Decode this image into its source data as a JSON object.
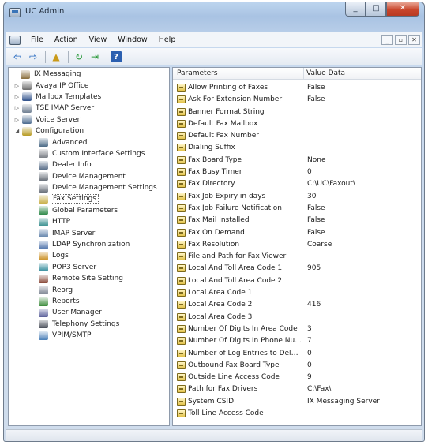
{
  "window": {
    "title": "UC Admin",
    "caption_buttons": {
      "minimize": "_",
      "maximize": "□",
      "close": "✕"
    }
  },
  "menubar": {
    "items": [
      "File",
      "Action",
      "View",
      "Window",
      "Help"
    ],
    "mdi_buttons": {
      "minimize": "_",
      "restore": "▫",
      "close": "✕"
    }
  },
  "toolbar": {
    "buttons": [
      {
        "name": "back",
        "icon": "arrow-left-icon",
        "glyph": "⇦"
      },
      {
        "name": "forward",
        "icon": "arrow-right-icon",
        "glyph": "⇨"
      },
      {
        "name": "up",
        "icon": "folder-up-icon",
        "glyph": "▲"
      },
      {
        "name": "refresh",
        "icon": "refresh-icon",
        "glyph": "↻"
      },
      {
        "name": "export",
        "icon": "export-icon",
        "glyph": "⇥"
      },
      {
        "name": "help",
        "icon": "help-icon",
        "glyph": "?"
      }
    ]
  },
  "tree": {
    "nodes": [
      {
        "label": "IX Messaging",
        "level": 0,
        "expander": "",
        "icon_color": "#8a6d3b",
        "icon": "server-group-icon"
      },
      {
        "label": "Avaya IP Office",
        "level": 1,
        "expander": "▷",
        "icon_color": "#6d6d6d",
        "icon": "phone-system-icon"
      },
      {
        "label": "Mailbox Templates",
        "level": 1,
        "expander": "▷",
        "icon_color": "#2d4f8a",
        "icon": "template-icon"
      },
      {
        "label": "TSE IMAP Server",
        "level": 1,
        "expander": "▷",
        "icon_color": "#6f7f92",
        "icon": "server-icon"
      },
      {
        "label": "Voice Server",
        "level": 1,
        "expander": "▷",
        "icon_color": "#4c6b8f",
        "icon": "voice-server-icon"
      },
      {
        "label": "Configuration",
        "level": 1,
        "expander": "◢",
        "icon_color": "#b79a22",
        "icon": "configuration-icon"
      },
      {
        "label": "Advanced",
        "level": 2,
        "icon_color": "#4b6a86",
        "icon": "advanced-icon"
      },
      {
        "label": "Custom Interface Settings",
        "level": 2,
        "icon_color": "#7b7f86",
        "icon": "interface-icon"
      },
      {
        "label": "Dealer Info",
        "level": 2,
        "icon_color": "#5a6f8a",
        "icon": "dealer-icon"
      },
      {
        "label": "Device Management",
        "level": 2,
        "icon_color": "#69707a",
        "icon": "device-icon"
      },
      {
        "label": "Device Management Settings",
        "level": 2,
        "icon_color": "#69707a",
        "icon": "device-settings-icon"
      },
      {
        "label": "Fax Settings",
        "level": 2,
        "icon_color": "#c9b04a",
        "icon": "fax-icon",
        "selected": true
      },
      {
        "label": "Global Parameters",
        "level": 2,
        "icon_color": "#2f8a4a",
        "icon": "globe-icon"
      },
      {
        "label": "HTTP",
        "level": 2,
        "icon_color": "#2f8a8a",
        "icon": "http-icon"
      },
      {
        "label": "IMAP Server",
        "level": 2,
        "icon_color": "#5d7fa8",
        "icon": "imap-icon"
      },
      {
        "label": "LDAP Synchronization",
        "level": 2,
        "icon_color": "#4a6fa8",
        "icon": "ldap-icon"
      },
      {
        "label": "Logs",
        "level": 2,
        "icon_color": "#c98b1a",
        "icon": "logs-icon"
      },
      {
        "label": "POP3 Server",
        "level": 2,
        "icon_color": "#2f8a9a",
        "icon": "pop3-icon"
      },
      {
        "label": "Remote Site Setting",
        "level": 2,
        "icon_color": "#8a4a3a",
        "icon": "remote-site-icon"
      },
      {
        "label": "Reorg",
        "level": 2,
        "icon_color": "#7a8290",
        "icon": "reorg-icon"
      },
      {
        "label": "Reports",
        "level": 2,
        "icon_color": "#3a8a3a",
        "icon": "reports-icon"
      },
      {
        "label": "User Manager",
        "level": 2,
        "icon_color": "#5a5f9a",
        "icon": "user-manager-icon"
      },
      {
        "label": "Telephony Settings",
        "level": 2,
        "icon_color": "#4a4f5a",
        "icon": "telephony-icon"
      },
      {
        "label": "VPIM/SMTP",
        "level": 2,
        "icon_color": "#4a7fb8",
        "icon": "vpim-icon"
      }
    ]
  },
  "list": {
    "headers": {
      "parameters": "Parameters",
      "value": "Value Data"
    },
    "rows": [
      {
        "name": "Allow Printing of Faxes",
        "value": "False"
      },
      {
        "name": "Ask For Extension Number",
        "value": "False"
      },
      {
        "name": "Banner Format String",
        "value": ""
      },
      {
        "name": "Default Fax Mailbox",
        "value": ""
      },
      {
        "name": "Default Fax Number",
        "value": ""
      },
      {
        "name": "Dialing Suffix",
        "value": ""
      },
      {
        "name": "Fax Board Type",
        "value": "None"
      },
      {
        "name": "Fax Busy Timer",
        "value": "0"
      },
      {
        "name": "Fax Directory",
        "value": "C:\\UC\\Faxout\\"
      },
      {
        "name": "Fax Job Expiry in days",
        "value": "30"
      },
      {
        "name": "Fax Job Failure Notification",
        "value": "False"
      },
      {
        "name": "Fax Mail Installed",
        "value": "False"
      },
      {
        "name": "Fax On Demand",
        "value": "False"
      },
      {
        "name": "Fax Resolution",
        "value": "Coarse"
      },
      {
        "name": "File and Path for Fax Viewer",
        "value": ""
      },
      {
        "name": "Local And Toll Area Code 1",
        "value": "905"
      },
      {
        "name": "Local And Toll Area Code 2",
        "value": ""
      },
      {
        "name": "Local Area Code 1",
        "value": ""
      },
      {
        "name": "Local Area Code 2",
        "value": "416"
      },
      {
        "name": "Local Area Code 3",
        "value": ""
      },
      {
        "name": "Number Of Digits In Area Code",
        "value": "3"
      },
      {
        "name": "Number Of Digits In Phone Nu...",
        "value": "7"
      },
      {
        "name": "Number of Log Entries to Delete",
        "value": "0"
      },
      {
        "name": "Outbound Fax Board Type",
        "value": "0"
      },
      {
        "name": "Outside Line Access Code",
        "value": "9"
      },
      {
        "name": "Path for Fax Drivers",
        "value": "C:\\Fax\\"
      },
      {
        "name": "System CSID",
        "value": "IX Messaging Server"
      },
      {
        "name": "Toll Line Access Code",
        "value": ""
      }
    ]
  },
  "statusbar": {
    "text": ""
  }
}
